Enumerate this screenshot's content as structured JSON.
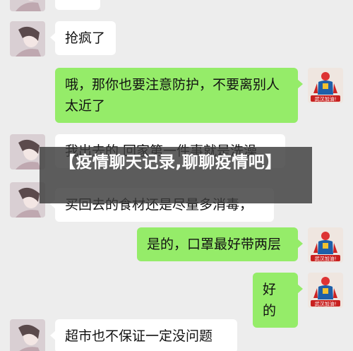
{
  "messages": [
    {
      "side": "left",
      "text": "抢疯了"
    },
    {
      "side": "right",
      "text": "哦，那你也要注意防护，不要离别人太近了"
    },
    {
      "side": "left",
      "text": "我出去的 回家第一件事就是洗澡"
    },
    {
      "side": "left",
      "text": "买回去的食材还是尽量多消毒，"
    },
    {
      "side": "right",
      "text": "是的，口罩最好带两层"
    },
    {
      "side": "right",
      "text": "好的"
    },
    {
      "side": "left",
      "text": "超市也不保证一定没问题"
    }
  ],
  "avatar_right": {
    "caption": "武汉加油!",
    "icon": "hero-icon"
  },
  "avatar_left": {
    "icon": "person-photo-icon"
  },
  "banner": {
    "title": "【疫情聊天记录,聊聊疫情吧】"
  },
  "colors": {
    "background": "#ededed",
    "self_bubble": "#95ec69",
    "other_bubble": "#ffffff",
    "banner_bg": "#3c3c3c"
  }
}
